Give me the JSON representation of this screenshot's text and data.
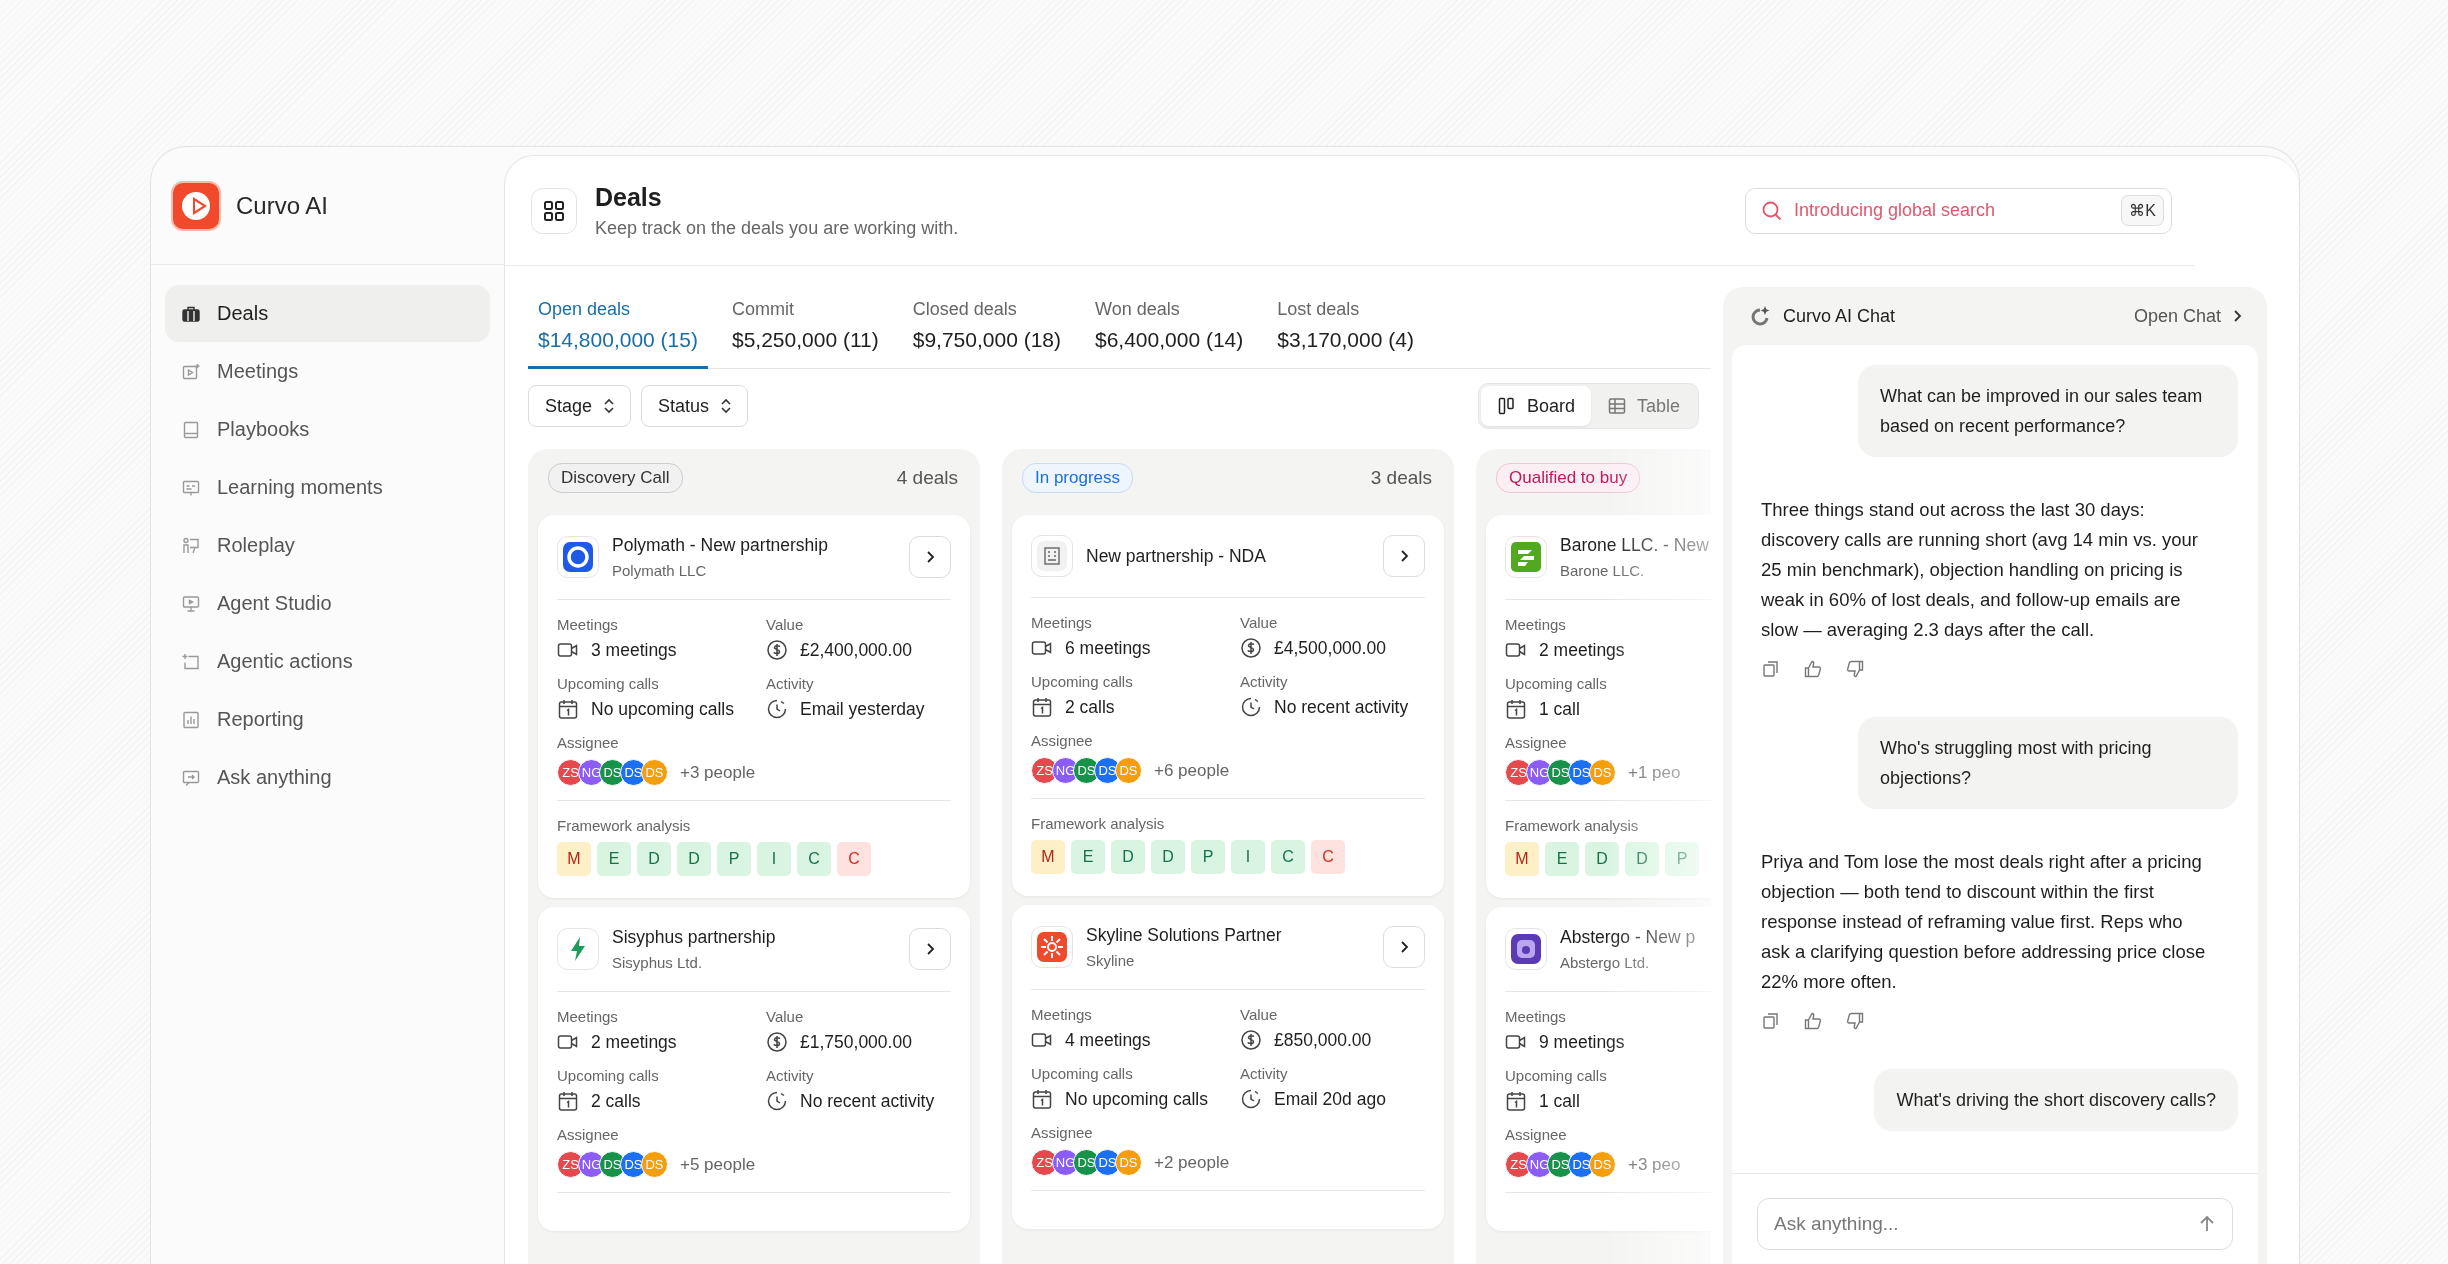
{
  "sidebar": {
    "brand": "Curvo AI",
    "items": [
      {
        "label": "Deals",
        "selected": true
      },
      {
        "label": "Meetings",
        "selected": false
      },
      {
        "label": "Playbooks",
        "selected": false
      },
      {
        "label": "Learning moments",
        "selected": false
      },
      {
        "label": "Roleplay",
        "selected": false
      },
      {
        "label": "Agent Studio",
        "selected": false
      },
      {
        "label": "Agentic actions",
        "selected": false
      },
      {
        "label": "Reporting",
        "selected": false
      },
      {
        "label": "Ask anything",
        "selected": false
      }
    ]
  },
  "header": {
    "title": "Deals",
    "subtitle": "Keep track on the deals you are working with.",
    "search": {
      "placeholder": "Introducing global search",
      "shortcut": "⌘K"
    }
  },
  "tabs": [
    {
      "label": "Open deals",
      "value": "$14,800,000 (15)",
      "selected": true
    },
    {
      "label": "Commit",
      "value": "$5,250,000 (11)",
      "selected": false
    },
    {
      "label": "Closed deals",
      "value": "$9,750,000 (18)",
      "selected": false
    },
    {
      "label": "Won deals",
      "value": "$6,400,000 (14)",
      "selected": false
    },
    {
      "label": "Lost deals",
      "value": "$3,170,000 (4)",
      "selected": false
    }
  ],
  "filters": [
    "Stage",
    "Status"
  ],
  "view_toggle": [
    {
      "label": "Board",
      "kind": "board",
      "selected": true
    },
    {
      "label": "Table",
      "kind": "table",
      "selected": false
    }
  ],
  "columns": [
    {
      "stage": "Discovery Call",
      "color": "#333333",
      "count": "4 deals",
      "cards": [
        {
          "logo": {
            "kind": "ring"
          },
          "title": "Polymath - New partnership",
          "company": "Polymath LLC",
          "open_button": true,
          "rows": [
            [
              {
                "kind": "meetings",
                "label": "Meetings",
                "value": "3 meetings"
              },
              {
                "kind": "value",
                "label": "Value",
                "value": "£2,400,000.00"
              }
            ],
            [
              {
                "kind": "calls",
                "label": "Upcoming calls",
                "value": "No upcoming calls"
              },
              {
                "kind": "activity",
                "label": "Activity",
                "value": "Email yesterday"
              }
            ]
          ],
          "assignee_label": "Assignee",
          "avatars": [
            {
              "initials": "ZS",
              "color": "#e5484d"
            },
            {
              "initials": "NG",
              "color": "#8b5cf6"
            },
            {
              "initials": "DS",
              "color": "#16924a"
            },
            {
              "initials": "DS",
              "color": "#1d6ff2"
            },
            {
              "initials": "DS",
              "color": "#f59e0b"
            }
          ],
          "more": "+3 people",
          "framework": {
            "label": "Framework analysis",
            "chips": [
              {
                "letter": "M",
                "kind": "partial"
              },
              {
                "letter": "E",
                "kind": "met"
              },
              {
                "letter": "D",
                "kind": "met"
              },
              {
                "letter": "D",
                "kind": "met"
              },
              {
                "letter": "P",
                "kind": "met"
              },
              {
                "letter": "I",
                "kind": "met"
              },
              {
                "letter": "C",
                "kind": "met"
              },
              {
                "letter": "C",
                "kind": "gap"
              }
            ]
          }
        },
        {
          "logo": {
            "kind": "bolt"
          },
          "title": "Sisyphus partnership",
          "company": "Sisyphus Ltd.",
          "open_button": true,
          "rows": [
            [
              {
                "kind": "meetings",
                "label": "Meetings",
                "value": "2 meetings"
              },
              {
                "kind": "value",
                "label": "Value",
                "value": "£1,750,000.00"
              }
            ],
            [
              {
                "kind": "calls",
                "label": "Upcoming calls",
                "value": "2 calls"
              },
              {
                "kind": "activity",
                "label": "Activity",
                "value": "No recent activity"
              }
            ]
          ],
          "assignee_label": "Assignee",
          "avatars": [
            {
              "initials": "ZS",
              "color": "#e5484d"
            },
            {
              "initials": "NG",
              "color": "#8b5cf6"
            },
            {
              "initials": "DS",
              "color": "#16924a"
            },
            {
              "initials": "DS",
              "color": "#1d6ff2"
            },
            {
              "initials": "DS",
              "color": "#f59e0b"
            }
          ],
          "more": "+5 people"
        }
      ]
    },
    {
      "stage": "In progress",
      "color": "#1d6fd8",
      "count": "3 deals",
      "cards": [
        {
          "logo": {
            "kind": "building"
          },
          "title": "New partnership - NDA",
          "open_button": true,
          "rows": [
            [
              {
                "kind": "meetings",
                "label": "Meetings",
                "value": "6 meetings"
              },
              {
                "kind": "value",
                "label": "Value",
                "value": "£4,500,000.00"
              }
            ],
            [
              {
                "kind": "calls",
                "label": "Upcoming calls",
                "value": "2 calls"
              },
              {
                "kind": "activity",
                "label": "Activity",
                "value": "No recent activity"
              }
            ]
          ],
          "assignee_label": "Assignee",
          "avatars": [
            {
              "initials": "ZS",
              "color": "#e5484d"
            },
            {
              "initials": "NG",
              "color": "#8b5cf6"
            },
            {
              "initials": "DS",
              "color": "#16924a"
            },
            {
              "initials": "DS",
              "color": "#1d6ff2"
            },
            {
              "initials": "DS",
              "color": "#f59e0b"
            }
          ],
          "more": "+6 people",
          "framework": {
            "label": "Framework analysis",
            "chips": [
              {
                "letter": "M",
                "kind": "partial"
              },
              {
                "letter": "E",
                "kind": "met"
              },
              {
                "letter": "D",
                "kind": "met"
              },
              {
                "letter": "D",
                "kind": "met"
              },
              {
                "letter": "P",
                "kind": "met"
              },
              {
                "letter": "I",
                "kind": "met"
              },
              {
                "letter": "C",
                "kind": "met"
              },
              {
                "letter": "C",
                "kind": "gap"
              }
            ]
          }
        },
        {
          "logo": {
            "kind": "sun"
          },
          "title": "Skyline Solutions Partner",
          "company": "Skyline",
          "open_button": true,
          "rows": [
            [
              {
                "kind": "meetings",
                "label": "Meetings",
                "value": "4 meetings"
              },
              {
                "kind": "value",
                "label": "Value",
                "value": "£850,000.00"
              }
            ],
            [
              {
                "kind": "calls",
                "label": "Upcoming calls",
                "value": "No upcoming calls"
              },
              {
                "kind": "activity",
                "label": "Activity",
                "value": "Email 20d ago"
              }
            ]
          ],
          "assignee_label": "Assignee",
          "avatars": [
            {
              "initials": "ZS",
              "color": "#e5484d"
            },
            {
              "initials": "NG",
              "color": "#8b5cf6"
            },
            {
              "initials": "DS",
              "color": "#16924a"
            },
            {
              "initials": "DS",
              "color": "#1d6ff2"
            },
            {
              "initials": "DS",
              "color": "#f59e0b"
            }
          ],
          "more": "+2 people"
        }
      ]
    },
    {
      "stage": "Qualified to buy",
      "color": "#c2185b",
      "cards": [
        {
          "logo": {
            "kind": "stripes"
          },
          "title": "Barone LLC. - New",
          "company": "Barone LLC.",
          "rows": [
            [
              {
                "kind": "meetings",
                "label": "Meetings",
                "value": "2 meetings"
              }
            ],
            [
              {
                "kind": "calls",
                "label": "Upcoming calls",
                "value": "1 call"
              }
            ]
          ],
          "assignee_label": "Assignee",
          "avatars": [
            {
              "initials": "ZS",
              "color": "#e5484d"
            },
            {
              "initials": "NG",
              "color": "#8b5cf6"
            },
            {
              "initials": "DS",
              "color": "#16924a"
            },
            {
              "initials": "DS",
              "color": "#1d6ff2"
            },
            {
              "initials": "DS",
              "color": "#f59e0b"
            }
          ],
          "more": "+1 peo",
          "framework": {
            "label": "Framework analysis",
            "chips": [
              {
                "letter": "M",
                "kind": "partial"
              },
              {
                "letter": "E",
                "kind": "met"
              },
              {
                "letter": "D",
                "kind": "met"
              },
              {
                "letter": "D",
                "kind": "met"
              },
              {
                "letter": "P",
                "kind": "met"
              }
            ]
          }
        },
        {
          "logo": {
            "kind": "square"
          },
          "title": "Abstergo - New p",
          "company": "Abstergo Ltd.",
          "rows": [
            [
              {
                "kind": "meetings",
                "label": "Meetings",
                "value": "9 meetings"
              }
            ],
            [
              {
                "kind": "calls",
                "label": "Upcoming calls",
                "value": "1 call"
              }
            ]
          ],
          "assignee_label": "Assignee",
          "avatars": [
            {
              "initials": "ZS",
              "color": "#e5484d"
            },
            {
              "initials": "NG",
              "color": "#8b5cf6"
            },
            {
              "initials": "DS",
              "color": "#16924a"
            },
            {
              "initials": "DS",
              "color": "#1d6ff2"
            },
            {
              "initials": "DS",
              "color": "#f59e0b"
            }
          ],
          "more": "+3 peo"
        }
      ]
    }
  ],
  "chat": {
    "title": "Curvo AI Chat",
    "open_label": "Open Chat",
    "messages": [
      {
        "kind": "user",
        "text": "What can be improved in our sales team based on recent performance?"
      },
      {
        "kind": "assistant",
        "text": "Three things stand out across the last 30 days: discovery calls are running short (avg 14 min vs. your 25 min benchmark), objection handling on pricing is weak in 60% of lost deals, and follow-up emails are slow — averaging 2.3 days after the call."
      },
      {
        "kind": "user",
        "text": "Who's struggling most with pricing objections?"
      },
      {
        "kind": "assistant",
        "text": "Priya and Tom lose the most deals right after a pricing objection — both tend to discount within the first response instead of reframing value first. Reps who ask a clarifying question before addressing price close 22% more often."
      },
      {
        "kind": "user",
        "text": "What's driving the short discovery calls?"
      }
    ],
    "input": {
      "placeholder": "Ask anything..."
    }
  }
}
